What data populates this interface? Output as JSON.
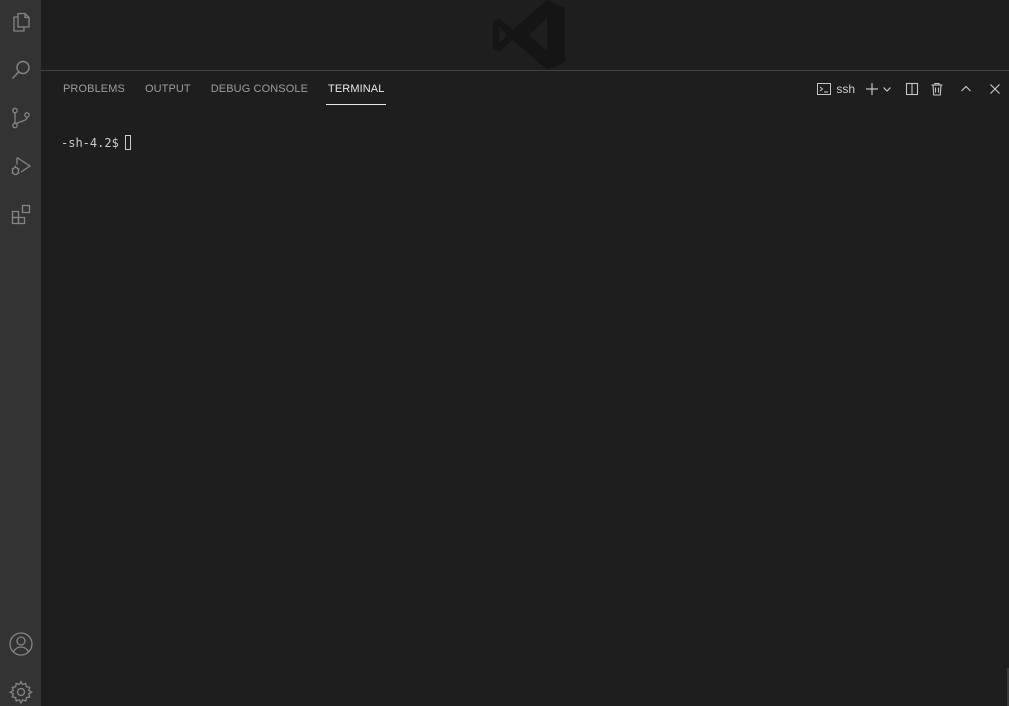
{
  "activity_bar": {
    "items": [
      {
        "icon": "files-icon"
      },
      {
        "icon": "search-icon"
      },
      {
        "icon": "source-control-icon"
      },
      {
        "icon": "run-debug-icon"
      },
      {
        "icon": "extensions-icon"
      }
    ],
    "bottom_items": [
      {
        "icon": "accounts-icon"
      },
      {
        "icon": "manage-gear-icon"
      }
    ]
  },
  "panel": {
    "tabs": [
      {
        "label": "PROBLEMS"
      },
      {
        "label": "OUTPUT"
      },
      {
        "label": "DEBUG CONSOLE"
      },
      {
        "label": "TERMINAL",
        "active": true
      }
    ],
    "actions": {
      "terminal_name": "ssh"
    }
  },
  "terminal": {
    "prompt": "-sh-4.2$"
  },
  "colors": {
    "background": "#1e1e1e",
    "activity_bar": "#333333",
    "foreground": "#cccccc",
    "inactive_tab": "#9d9d9d",
    "active_tab": "#e7e7e7"
  }
}
